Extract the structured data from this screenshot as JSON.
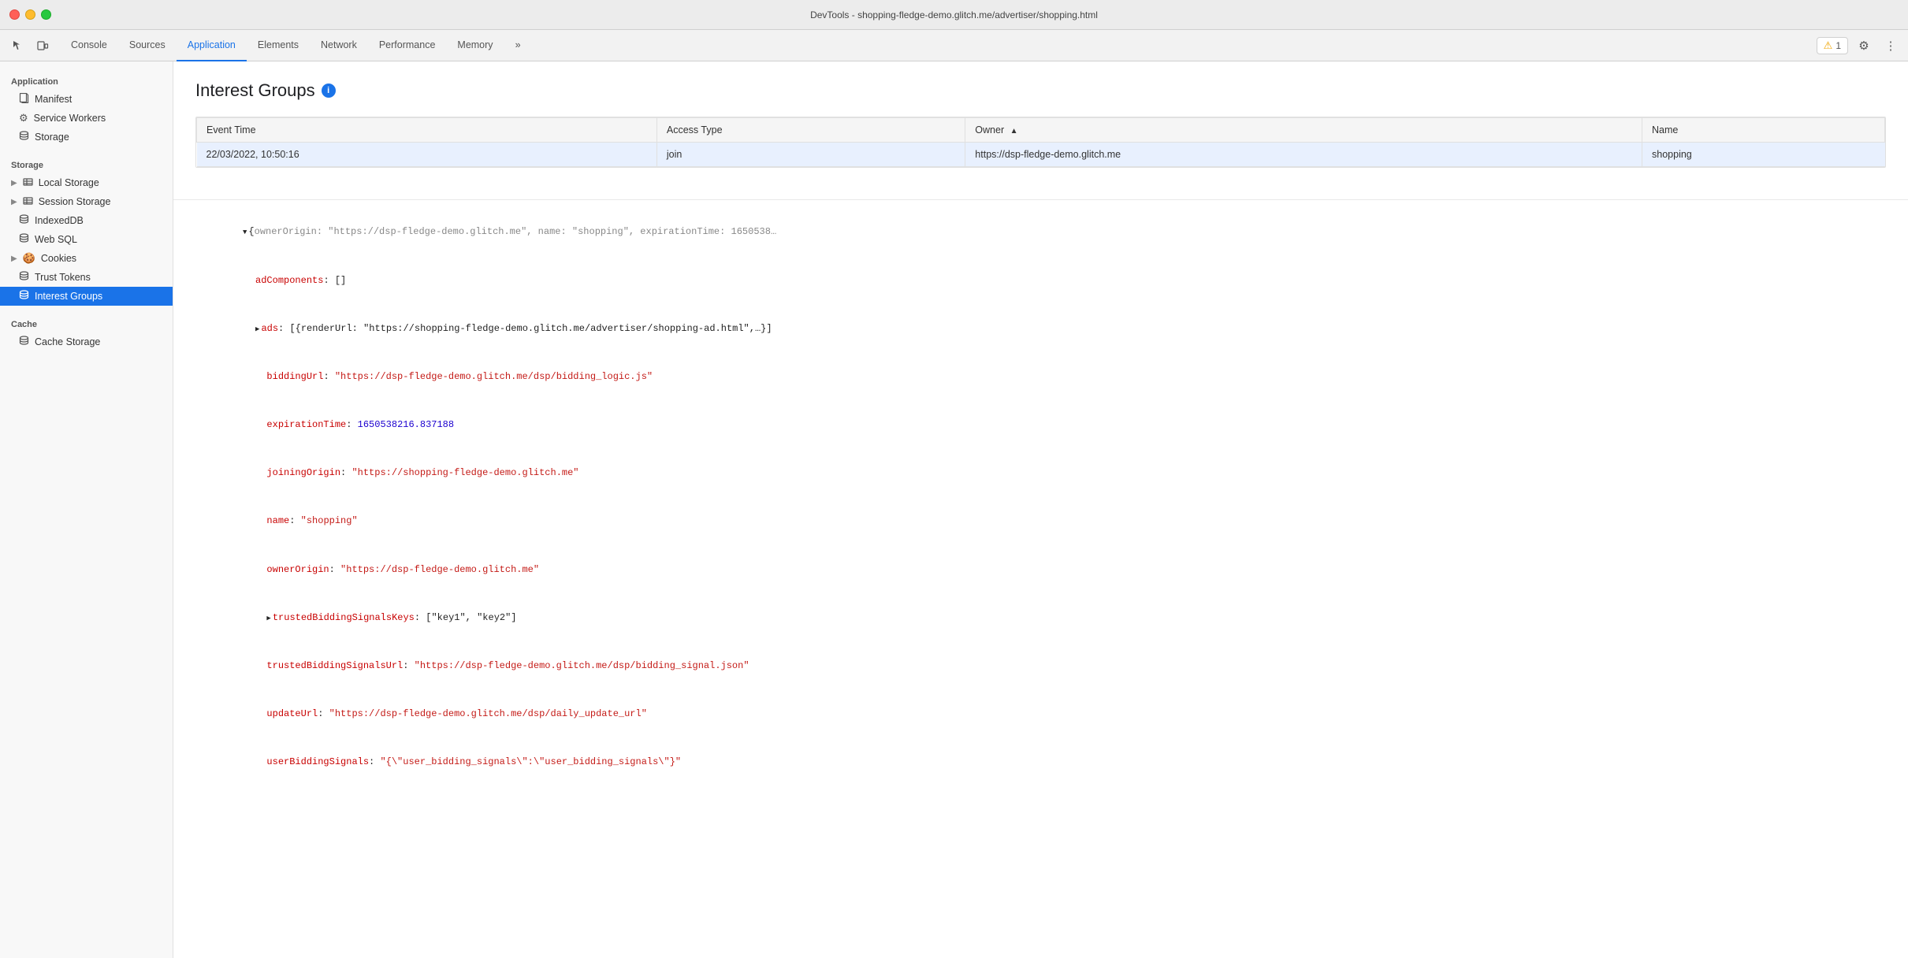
{
  "titlebar": {
    "title": "DevTools - shopping-fledge-demo.glitch.me/advertiser/shopping.html"
  },
  "toolbar": {
    "tabs": [
      {
        "label": "Console",
        "active": false
      },
      {
        "label": "Sources",
        "active": false
      },
      {
        "label": "Application",
        "active": true
      },
      {
        "label": "Elements",
        "active": false
      },
      {
        "label": "Network",
        "active": false
      },
      {
        "label": "Performance",
        "active": false
      },
      {
        "label": "Memory",
        "active": false
      },
      {
        "label": "»",
        "active": false
      }
    ],
    "warning_count": "1",
    "warning_label": "1"
  },
  "sidebar": {
    "application_section": "Application",
    "items_application": [
      {
        "label": "Manifest",
        "icon": "📄"
      },
      {
        "label": "Service Workers",
        "icon": "⚙"
      },
      {
        "label": "Storage",
        "icon": "🗄"
      }
    ],
    "storage_section": "Storage",
    "items_storage": [
      {
        "label": "Local Storage",
        "icon": "▤",
        "has_arrow": true
      },
      {
        "label": "Session Storage",
        "icon": "▤",
        "has_arrow": true
      },
      {
        "label": "IndexedDB",
        "icon": "🗄"
      },
      {
        "label": "Web SQL",
        "icon": "🗄"
      },
      {
        "label": "Cookies",
        "icon": "🍪",
        "has_arrow": true
      },
      {
        "label": "Trust Tokens",
        "icon": "🗄"
      },
      {
        "label": "Interest Groups",
        "icon": "🗄",
        "active": true
      }
    ],
    "cache_section": "Cache",
    "items_cache": [
      {
        "label": "Cache Storage",
        "icon": "🗄"
      }
    ]
  },
  "content": {
    "page_title": "Interest Groups",
    "table": {
      "columns": [
        {
          "label": "Event Time",
          "sortable": true,
          "sort_active": false
        },
        {
          "label": "Access Type",
          "sortable": false
        },
        {
          "label": "Owner",
          "sortable": true,
          "sort_active": true
        },
        {
          "label": "Name",
          "sortable": false
        }
      ],
      "rows": [
        {
          "event_time": "22/03/2022, 10:50:16",
          "access_type": "join",
          "owner": "https://dsp-fledge-demo.glitch.me",
          "name": "shopping"
        }
      ]
    },
    "json": {
      "root_open": "{ownerOrigin: \"https://dsp-fledge-demo.glitch.me\", name: \"shopping\", expirationTime: 1650538…",
      "ad_components": "adComponents: []",
      "ads_line": "ads: [{renderUrl: \"https://shopping-fledge-demo.glitch.me/advertiser/shopping-ad.html\",…}]",
      "bidding_url_key": "biddingUrl:",
      "bidding_url_val": "\"https://dsp-fledge-demo.glitch.me/dsp/bidding_logic.js\"",
      "expiration_key": "expirationTime:",
      "expiration_val": "1650538216.837188",
      "joining_key": "joiningOrigin:",
      "joining_val": "\"https://shopping-fledge-demo.glitch.me\"",
      "name_key": "name:",
      "name_val": "\"shopping\"",
      "owner_key": "ownerOrigin:",
      "owner_val": "\"https://dsp-fledge-demo.glitch.me\"",
      "trusted_keys_key": "trustedBiddingSignalsKeys:",
      "trusted_keys_val": "[\"key1\", \"key2\"]",
      "trusted_url_key": "trustedBiddingSignalsUrl:",
      "trusted_url_val": "\"https://dsp-fledge-demo.glitch.me/dsp/bidding_signal.json\"",
      "update_url_key": "updateUrl:",
      "update_url_val": "\"https://dsp-fledge-demo.glitch.me/dsp/daily_update_url\"",
      "user_bidding_key": "userBiddingSignals:",
      "user_bidding_val": "\"{\\\"user_bidding_signals\\\":\\\"user_bidding_signals\\\"}\""
    }
  }
}
